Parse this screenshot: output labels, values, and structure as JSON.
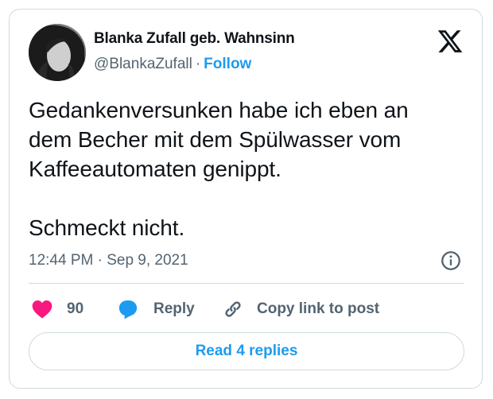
{
  "author": {
    "display_name": "Blanka Zufall geb. Wahnsinn",
    "handle": "@BlankaZufall",
    "separator": "·",
    "follow_label": "Follow"
  },
  "tweet": {
    "text": "Gedankenversunken habe ich eben an\ndem Becher mit dem Spülwasser vom\nKaffeeautomaten genippt.\n\nSchmeckt nicht.",
    "timestamp": "12:44 PM · Sep 9, 2021"
  },
  "actions": {
    "like_count": "90",
    "reply_label": "Reply",
    "copy_label": "Copy link to post"
  },
  "replies_button": "Read 4 replies",
  "icons": {
    "logo": "x-logo-icon",
    "info": "info-icon",
    "like": "heart-icon",
    "reply": "speech-bubble-icon",
    "copy": "link-icon"
  },
  "colors": {
    "accent": "#1d9bf0",
    "like": "#f91880",
    "muted": "#536471",
    "text": "#0f1419",
    "border": "#cfd9de"
  }
}
